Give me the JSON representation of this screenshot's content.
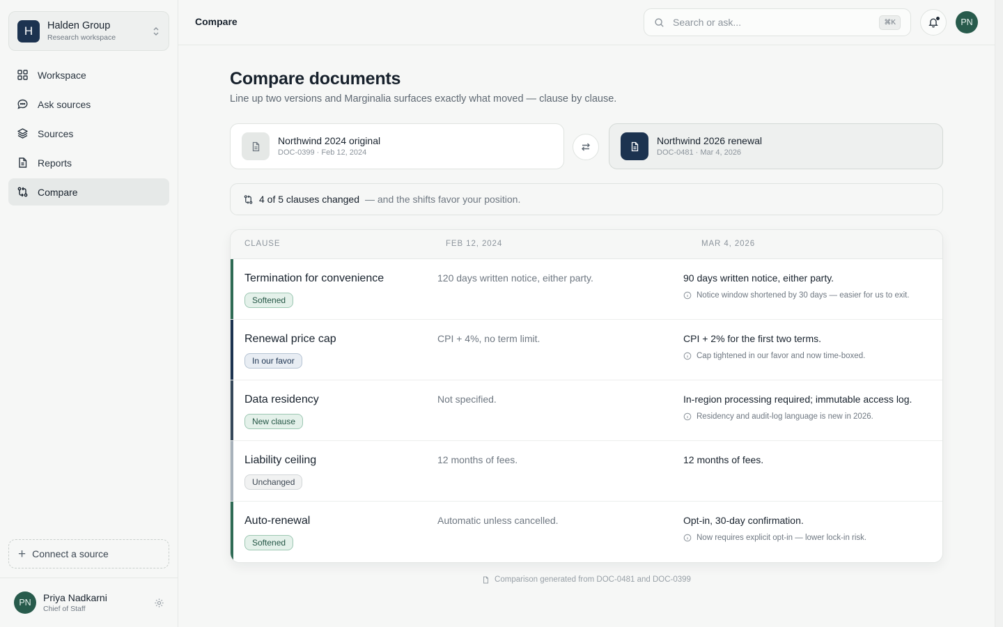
{
  "workspace": {
    "initial": "H",
    "name": "Halden Group",
    "subtitle": "Research workspace"
  },
  "nav": [
    {
      "label": "Workspace",
      "icon": "grid-icon",
      "active": false
    },
    {
      "label": "Ask sources",
      "icon": "chat-icon",
      "active": false
    },
    {
      "label": "Sources",
      "icon": "layers-icon",
      "active": false
    },
    {
      "label": "Reports",
      "icon": "report-icon",
      "active": false
    },
    {
      "label": "Compare",
      "icon": "compare-icon",
      "active": true
    }
  ],
  "connect_label": "Connect a source",
  "user": {
    "initials": "PN",
    "name": "Priya Nadkarni",
    "role": "Chief of Staff"
  },
  "topbar": {
    "title": "Compare",
    "search_placeholder": "Search or ask...",
    "shortcut": "⌘K",
    "avatar": "PN"
  },
  "page": {
    "title": "Compare documents",
    "subtitle": "Line up two versions and Marginalia surfaces exactly what moved — clause by clause."
  },
  "docs": {
    "left": {
      "title": "Northwind 2024 original",
      "meta": "DOC-0399 · Feb 12, 2024"
    },
    "right": {
      "title": "Northwind 2026 renewal",
      "meta": "DOC-0481 · Mar 4, 2026"
    }
  },
  "summary": {
    "count": "4 of 5 clauses changed",
    "rest": "— and the shifts favor your position."
  },
  "table": {
    "headers": {
      "clause": "Clause",
      "old": "Feb 12, 2024",
      "new": "Mar 4, 2026"
    },
    "rows": [
      {
        "clause": "Termination for convenience",
        "tag": "Softened",
        "tag_kind": "softened",
        "old": "120 days written notice, either party.",
        "new": "90 days written notice, either party.",
        "note": "Notice window shortened by 30 days — easier for us to exit."
      },
      {
        "clause": "Renewal price cap",
        "tag": "In our favor",
        "tag_kind": "favor",
        "old": "CPI + 4%, no term limit.",
        "new": "CPI + 2% for the first two terms.",
        "note": "Cap tightened in our favor and now time-boxed."
      },
      {
        "clause": "Data residency",
        "tag": "New clause",
        "tag_kind": "new",
        "old": "Not specified.",
        "new": "In-region processing required; immutable access log.",
        "note": "Residency and audit-log language is new in 2026."
      },
      {
        "clause": "Liability ceiling",
        "tag": "Unchanged",
        "tag_kind": "unchanged",
        "old": "12 months of fees.",
        "new": "12 months of fees.",
        "note": ""
      },
      {
        "clause": "Auto-renewal",
        "tag": "Softened",
        "tag_kind": "softened",
        "old": "Automatic unless cancelled.",
        "new": "Opt-in, 30-day confirmation.",
        "note": "Now requires explicit opt-in — lower lock-in risk."
      }
    ]
  },
  "footer_note": "Comparison generated from DOC-0481 and DOC-0399",
  "colors": {
    "softened": {
      "bar": "#2f6b55",
      "bg": "#e4f1ea",
      "border": "#9cc7b2",
      "text": "#245645"
    },
    "favor": {
      "bar": "#1c3350",
      "bg": "#e8edf3",
      "border": "#b5c3d3",
      "text": "#1c3350"
    },
    "new": {
      "bar": "#35485a",
      "bg": "#e4f1ea",
      "border": "#9cc7b2",
      "text": "#245645"
    },
    "unchanged": {
      "bar": "#a8b2bb",
      "bg": "#f1f2f2",
      "border": "#d2d6d8",
      "text": "#3b4651"
    }
  }
}
